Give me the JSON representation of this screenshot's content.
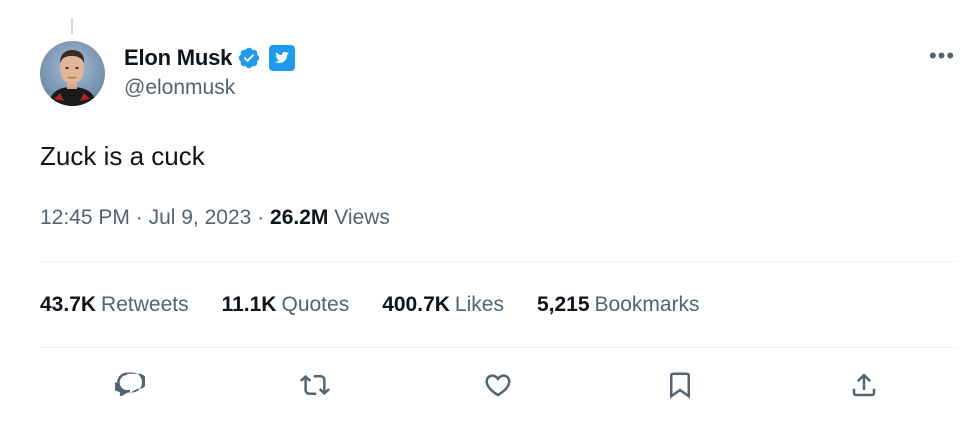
{
  "author": {
    "display_name": "Elon Musk",
    "handle": "@elonmusk",
    "avatar_icon": "profile-photo",
    "verified_icon": "verified-badge-icon",
    "affiliate_icon": "twitter-bird-badge-icon"
  },
  "menu": {
    "more_label": "•••"
  },
  "tweet": {
    "text": "Zuck is a cuck",
    "time": "12:45 PM",
    "separator": "·",
    "date": "Jul 9, 2023",
    "views_count": "26.2M",
    "views_label": "Views"
  },
  "stats": [
    {
      "count": "43.7K",
      "label": "Retweets"
    },
    {
      "count": "11.1K",
      "label": "Quotes"
    },
    {
      "count": "400.7K",
      "label": "Likes"
    },
    {
      "count": "5,215",
      "label": "Bookmarks"
    }
  ],
  "actions": [
    {
      "icon": "reply-icon"
    },
    {
      "icon": "retweet-icon"
    },
    {
      "icon": "like-icon"
    },
    {
      "icon": "bookmark-icon"
    },
    {
      "icon": "share-icon"
    }
  ],
  "colors": {
    "text_primary": "#0f1419",
    "text_secondary": "#536471",
    "verified_blue": "#1d9bf0",
    "divider": "#eff3f4"
  }
}
